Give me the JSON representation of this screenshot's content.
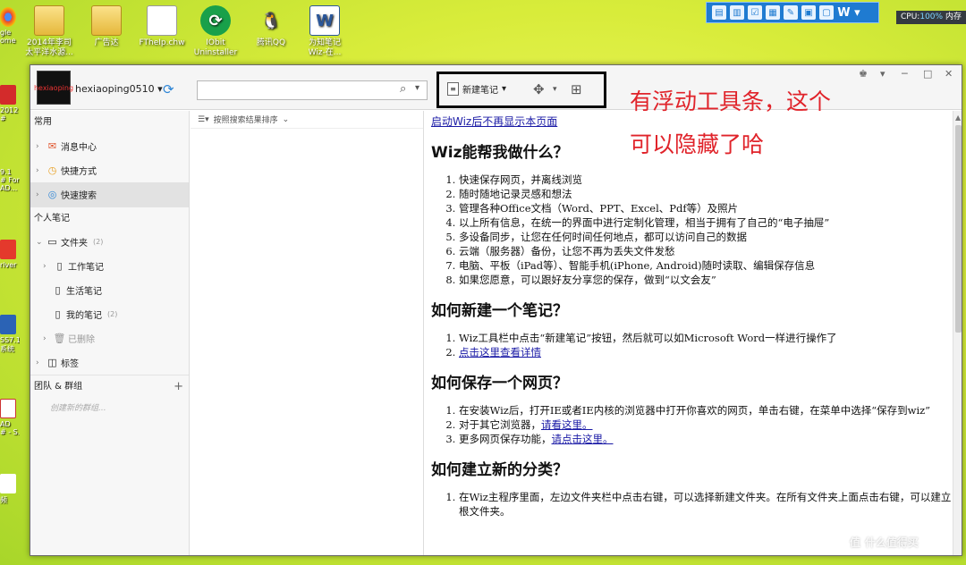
{
  "desktop": {
    "icons": [
      {
        "label": "2014年李司\n太平洋水源...",
        "icon": "folder-icon"
      },
      {
        "label": "广告达",
        "icon": "folder-icon"
      },
      {
        "label": "FTheIp.chw",
        "icon": "document-icon"
      },
      {
        "label": "IObit\nUninstaller",
        "icon": "iobit-icon"
      },
      {
        "label": "腾讯QQ",
        "icon": "qq-icon"
      },
      {
        "label": "为知笔记\nWiz-在...",
        "icon": "word-icon"
      }
    ],
    "left_labels": [
      "gle\nome",
      "2012 #",
      "9.1\n# For\nAD...",
      "river",
      "SS7.1\n系统",
      "AD\n# - S...",
      "频"
    ],
    "top_toolbar_logo": "W",
    "cpu_label": "CPU:",
    "cpu_value": "100%",
    "cpu_suffix": "内存"
  },
  "window": {
    "user": {
      "avatar_text": "hexiaoping",
      "name": "hexiaoping0510"
    },
    "search": {
      "placeholder": ""
    },
    "toolbar": {
      "new_note_label": "新建笔记"
    },
    "nav": {
      "section_common": "常用",
      "items_common": [
        {
          "label": "消息中心",
          "icon": "message-center-icon"
        },
        {
          "label": "快捷方式",
          "icon": "shortcut-icon"
        },
        {
          "label": "快速搜索",
          "icon": "quick-search-icon"
        }
      ],
      "section_personal": "个人笔记",
      "folder_root": {
        "label": "文件夹",
        "count": "(2)"
      },
      "folders": [
        {
          "label": "工作笔记",
          "count": ""
        },
        {
          "label": "生活笔记",
          "count": ""
        },
        {
          "label": "我的笔记",
          "count": "(2)"
        },
        {
          "label": "已删除",
          "count": ""
        }
      ],
      "tags_label": "标签",
      "section_team": "团队 & 群组",
      "create_group": "创建新的群组..."
    },
    "list": {
      "sort_label": "按照搜索结果排序"
    },
    "content": {
      "top_link": "启动Wiz后不再显示本页面",
      "sections": [
        {
          "heading": "Wiz能帮我做什么？",
          "items": [
            "快速保存网页，并离线浏览",
            "随时随地记录灵感和想法",
            "管理各种Office文档（Word、PPT、Excel、Pdf等）及照片",
            "以上所有信息，在统一的界面中进行定制化管理，相当于拥有了自己的“电子抽屉”",
            "多设备同步，让您在任何时间任何地点，都可以访问自己的数据",
            "云端（服务器）备份，让您不再为丢失文件发愁",
            "电脑、平板（iPad等）、智能手机(iPhone, Android)随时读取、编辑保存信息",
            "如果您愿意，可以跟好友分享您的保存，做到“以文会友”"
          ]
        },
        {
          "heading": "如何新建一个笔记？",
          "item1": "Wiz工具栏中点击“新建笔记”按钮，然后就可以如Microsoft Word一样进行操作了",
          "item2_link": "点击这里查看详情"
        },
        {
          "heading": "如何保存一个网页？",
          "item1": "在安装Wiz后，打开IE或者IE内核的浏览器中打开你喜欢的网页，单击右键，在菜单中选择“保存到wiz”",
          "item2_text": "对于其它浏览器，",
          "item2_link": "请看这里。",
          "item3_text": "更多网页保存功能，",
          "item3_link": "请点击这里。"
        },
        {
          "heading": "如何建立新的分类？",
          "item1": "在Wiz主程序里面，左边文件夹栏中点击右键，可以选择新建文件夹。在所有文件夹上面点击右键，可以建立根文件夹。"
        }
      ]
    }
  },
  "annotation": {
    "line1": "有浮动工具条，这个",
    "line2": "可以隐藏了哈"
  },
  "watermark": {
    "symbol": "值",
    "text": "什么值得买"
  }
}
